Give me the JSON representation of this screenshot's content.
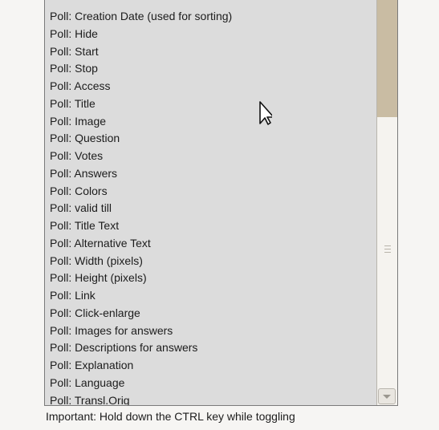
{
  "listbox": {
    "items": [
      "Poll: Creation Date (used for sorting)",
      "Poll: Hide",
      "Poll: Start",
      "Poll: Stop",
      "Poll: Access",
      "Poll: Title",
      "Poll: Image",
      "Poll: Question",
      "Poll: Votes",
      "Poll: Answers",
      "Poll: Colors",
      "Poll: valid till",
      "Poll: Title Text",
      "Poll: Alternative Text",
      "Poll: Width (pixels)",
      "Poll: Height (pixels)",
      "Poll: Link",
      "Poll: Click-enlarge",
      "Poll: Images for answers",
      "Poll: Descriptions for answers",
      "Poll: Explanation",
      "Poll: Language",
      "Poll: Transl.Orig"
    ]
  },
  "help_text": "Important: Hold down the CTRL key while toggling"
}
